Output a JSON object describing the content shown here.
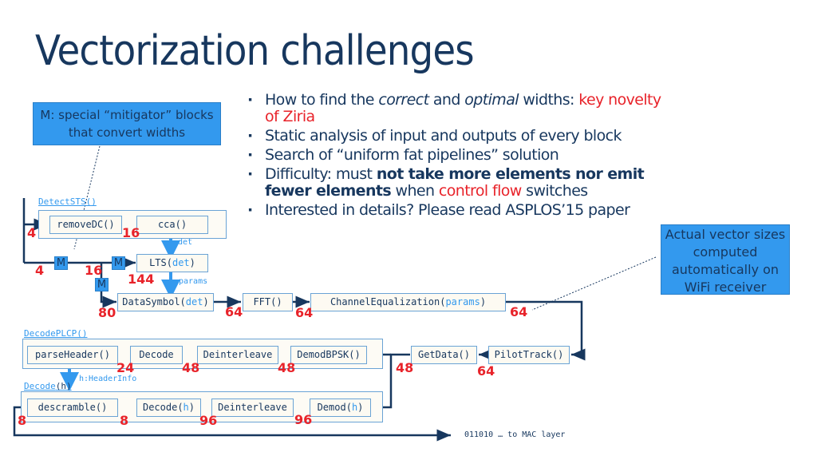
{
  "slide": {
    "title": "Vectorization challenges",
    "bullets": [
      {
        "parts": [
          {
            "t": "How to find the ",
            "s": ""
          },
          {
            "t": "correct",
            "s": "italic"
          },
          {
            "t": " and ",
            "s": ""
          },
          {
            "t": "optimal",
            "s": "italic"
          },
          {
            "t": " widths: ",
            "s": ""
          },
          {
            "t": "key novelty of Ziria",
            "s": "red"
          }
        ]
      },
      {
        "parts": [
          {
            "t": "Static analysis of input and outputs of every block",
            "s": ""
          }
        ]
      },
      {
        "parts": [
          {
            "t": "Search of “uniform fat pipelines” solution",
            "s": ""
          }
        ]
      },
      {
        "parts": [
          {
            "t": "Difficulty: must ",
            "s": ""
          },
          {
            "t": "not take more elements nor emit fewer elements",
            "s": "bold"
          },
          {
            "t": " when ",
            "s": ""
          },
          {
            "t": "control flow",
            "s": "red"
          },
          {
            "t": " switches",
            "s": ""
          }
        ]
      },
      {
        "parts": [
          {
            "t": "Interested in details? Please read ASPLOS’15 paper",
            "s": ""
          }
        ]
      }
    ],
    "callouts": {
      "mitigator": "M: special “mitigator” blocks that convert widths",
      "wifi": "Actual vector sizes computed automatically on WiFi receiver"
    }
  },
  "diagram": {
    "groups": {
      "detect_sts": "DetectSTS()",
      "decode_plcp": "DecodePLCP()",
      "decode_h_name": "Decode",
      "decode_h_arg": "(h)"
    },
    "blocks": {
      "removeDC": "removeDC()",
      "cca": "cca()",
      "lts_name": "LTS(",
      "lts_arg": "det",
      "datasymbol_name": "DataSymbol(",
      "datasymbol_arg": "det",
      "close": ")",
      "fft": "FFT()",
      "chaneq_name": "ChannelEqualization(",
      "chaneq_arg": "params",
      "parseHeader": "parseHeader()",
      "decode1": "Decode",
      "deinterleave1": "Deinterleave",
      "demodbpsk": "DemodBPSK()",
      "getdata": "GetData()",
      "pilottrack": "PilotTrack()",
      "descramble": "descramble()",
      "decode2_name": "Decode(",
      "decode2_arg": "h",
      "deinterleave2": "Deinterleave",
      "demod_name": "Demod(",
      "demod_arg": "h"
    },
    "mitigator_label": "M",
    "edge_labels": {
      "det": "det",
      "params": "params",
      "header_info": "h:HeaderInfo"
    },
    "widths": {
      "in_detect": "4",
      "removeDC_out": "16",
      "in_m1": "4",
      "m1_out": "16",
      "lts_out": "144",
      "datasymbol_in": "80",
      "datasymbol_out": "64",
      "fft_out": "64",
      "chaneq_out": "64",
      "parseheader_in": "24",
      "decode1_in": "48",
      "deinterleave1_in": "48",
      "getdata_out": "48",
      "pilottrack_out": "64",
      "descramble_out": "8",
      "descramble_in": "8",
      "decode2_in": "96",
      "deinterleave2_in": "96"
    },
    "output_label": "011010 … to MAC layer"
  },
  "colors": {
    "dark": "#17375e",
    "accent_blue": "#3399ee",
    "red": "#e8232a",
    "block_border": "#6aa3d5"
  }
}
